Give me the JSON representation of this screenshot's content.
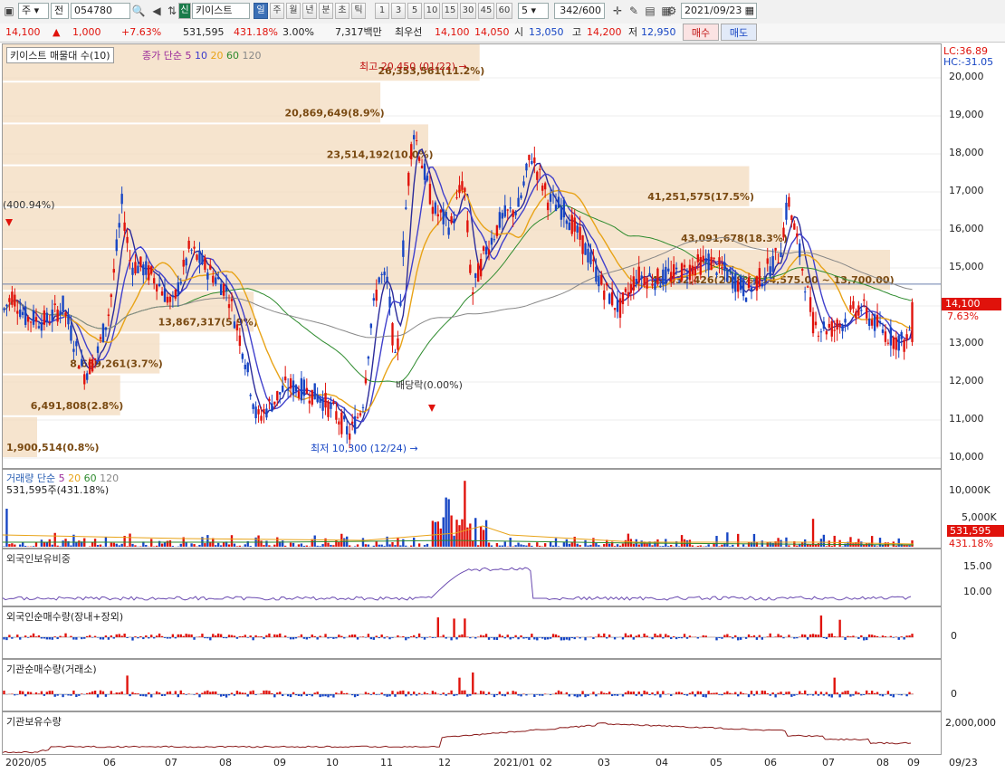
{
  "toolbar": {
    "period_select": "주",
    "market_select": "전",
    "code": "054780",
    "credit_badge": "신",
    "stock_name": "키이스트",
    "period_buttons": [
      "일",
      "주",
      "월",
      "년",
      "분",
      "초",
      "틱"
    ],
    "interval_buttons": [
      "1",
      "3",
      "5",
      "10",
      "15",
      "30",
      "45",
      "60"
    ],
    "unit_value": "5",
    "count_display": "342",
    "count_total": "/600",
    "date_value": "2021/09/23"
  },
  "quote": {
    "price": "14,100",
    "change": "1,000",
    "change_pct": "+7.63%",
    "volume": "531,595",
    "volume_ratio": "431.18%",
    "turnover": "3.00%",
    "amount": "7,317백만",
    "prio_label": "최우선",
    "ask1": "14,100",
    "bid1": "14,050",
    "open_label": "시",
    "open": "13,050",
    "high_label": "고",
    "high": "14,200",
    "low_label": "저",
    "low": "12,950",
    "buy_label": "매수",
    "sell_label": "매도"
  },
  "price_panel": {
    "title": "키이스트 매물대 수(10)",
    "ma_label": "종가 단순",
    "ma_periods": [
      "5",
      "10",
      "20",
      "60",
      "120"
    ],
    "lc": "LC:36.89",
    "hc": "HC:-31.05",
    "high_note": "최고 20,450 (01/22)",
    "low_note": "최저 10,300 (12/24)",
    "dividend_note": "배당락(0.00%)",
    "left_note": "(400.94%)",
    "price_tag": "14,100",
    "pct_tag": "7.63%",
    "yticks": [
      "20,000",
      "19,000",
      "18,000",
      "17,000",
      "16,000",
      "15,000",
      "14,000",
      "13,000",
      "12,000",
      "11,000",
      "10,000"
    ],
    "volume_profile": [
      {
        "label": "1,900,514(0.8%)",
        "value": 1900514
      },
      {
        "label": "6,491,808(2.8%)",
        "value": 6491808
      },
      {
        "label": "8,669,261(3.7%)",
        "value": 8669261
      },
      {
        "label": "13,867,317(5.9%)",
        "value": 13867317
      },
      {
        "label": "49,032,426(20.8%)(14,575.00 ~ 13,700.00)",
        "value": 49032426
      },
      {
        "label": "43,091,678(18.3%)",
        "value": 43091678
      },
      {
        "label": "41,251,575(17.5%)",
        "value": 41251575
      },
      {
        "label": "23,514,192(10.0%)",
        "value": 23514192
      },
      {
        "label": "20,869,649(8.9%)",
        "value": 20869649
      },
      {
        "label": "26,353,561(11.2%)",
        "value": 26353561
      }
    ]
  },
  "volume_panel": {
    "title": "거래량",
    "ma_label": "단순",
    "ma_periods": [
      "5",
      "20",
      "60",
      "120"
    ],
    "current": "531,595주(431.18%)",
    "yticks": [
      "10,000K",
      "5,000K"
    ],
    "tag1": "531,595",
    "tag2": "431.18%"
  },
  "foreign_ratio": {
    "title": "외국인보유비중",
    "yticks": [
      "15.00",
      "10.00"
    ]
  },
  "foreign_net": {
    "title": "외국인순매수량(장내+장외)",
    "ytick": "0"
  },
  "inst_net": {
    "title": "기관순매수량(거래소)",
    "ytick": "0"
  },
  "inst_hold": {
    "title": "기관보유수량",
    "ytick": "2,000,000"
  },
  "xaxis": [
    "2020/05",
    "06",
    "07",
    "08",
    "09",
    "10",
    "11",
    "12",
    "2021/01",
    "02",
    "03",
    "04",
    "05",
    "06",
    "07",
    "08",
    "09"
  ],
  "xaxis_end": "09/23",
  "colors": {
    "up": "#e0120b",
    "down": "#1645c4",
    "ma5": "#2a2a9a",
    "ma10": "#3a3acc",
    "ma20": "#e8a317",
    "ma60": "#2e8b2e",
    "ma120": "#888888",
    "profile": "#f4dfc6"
  }
}
